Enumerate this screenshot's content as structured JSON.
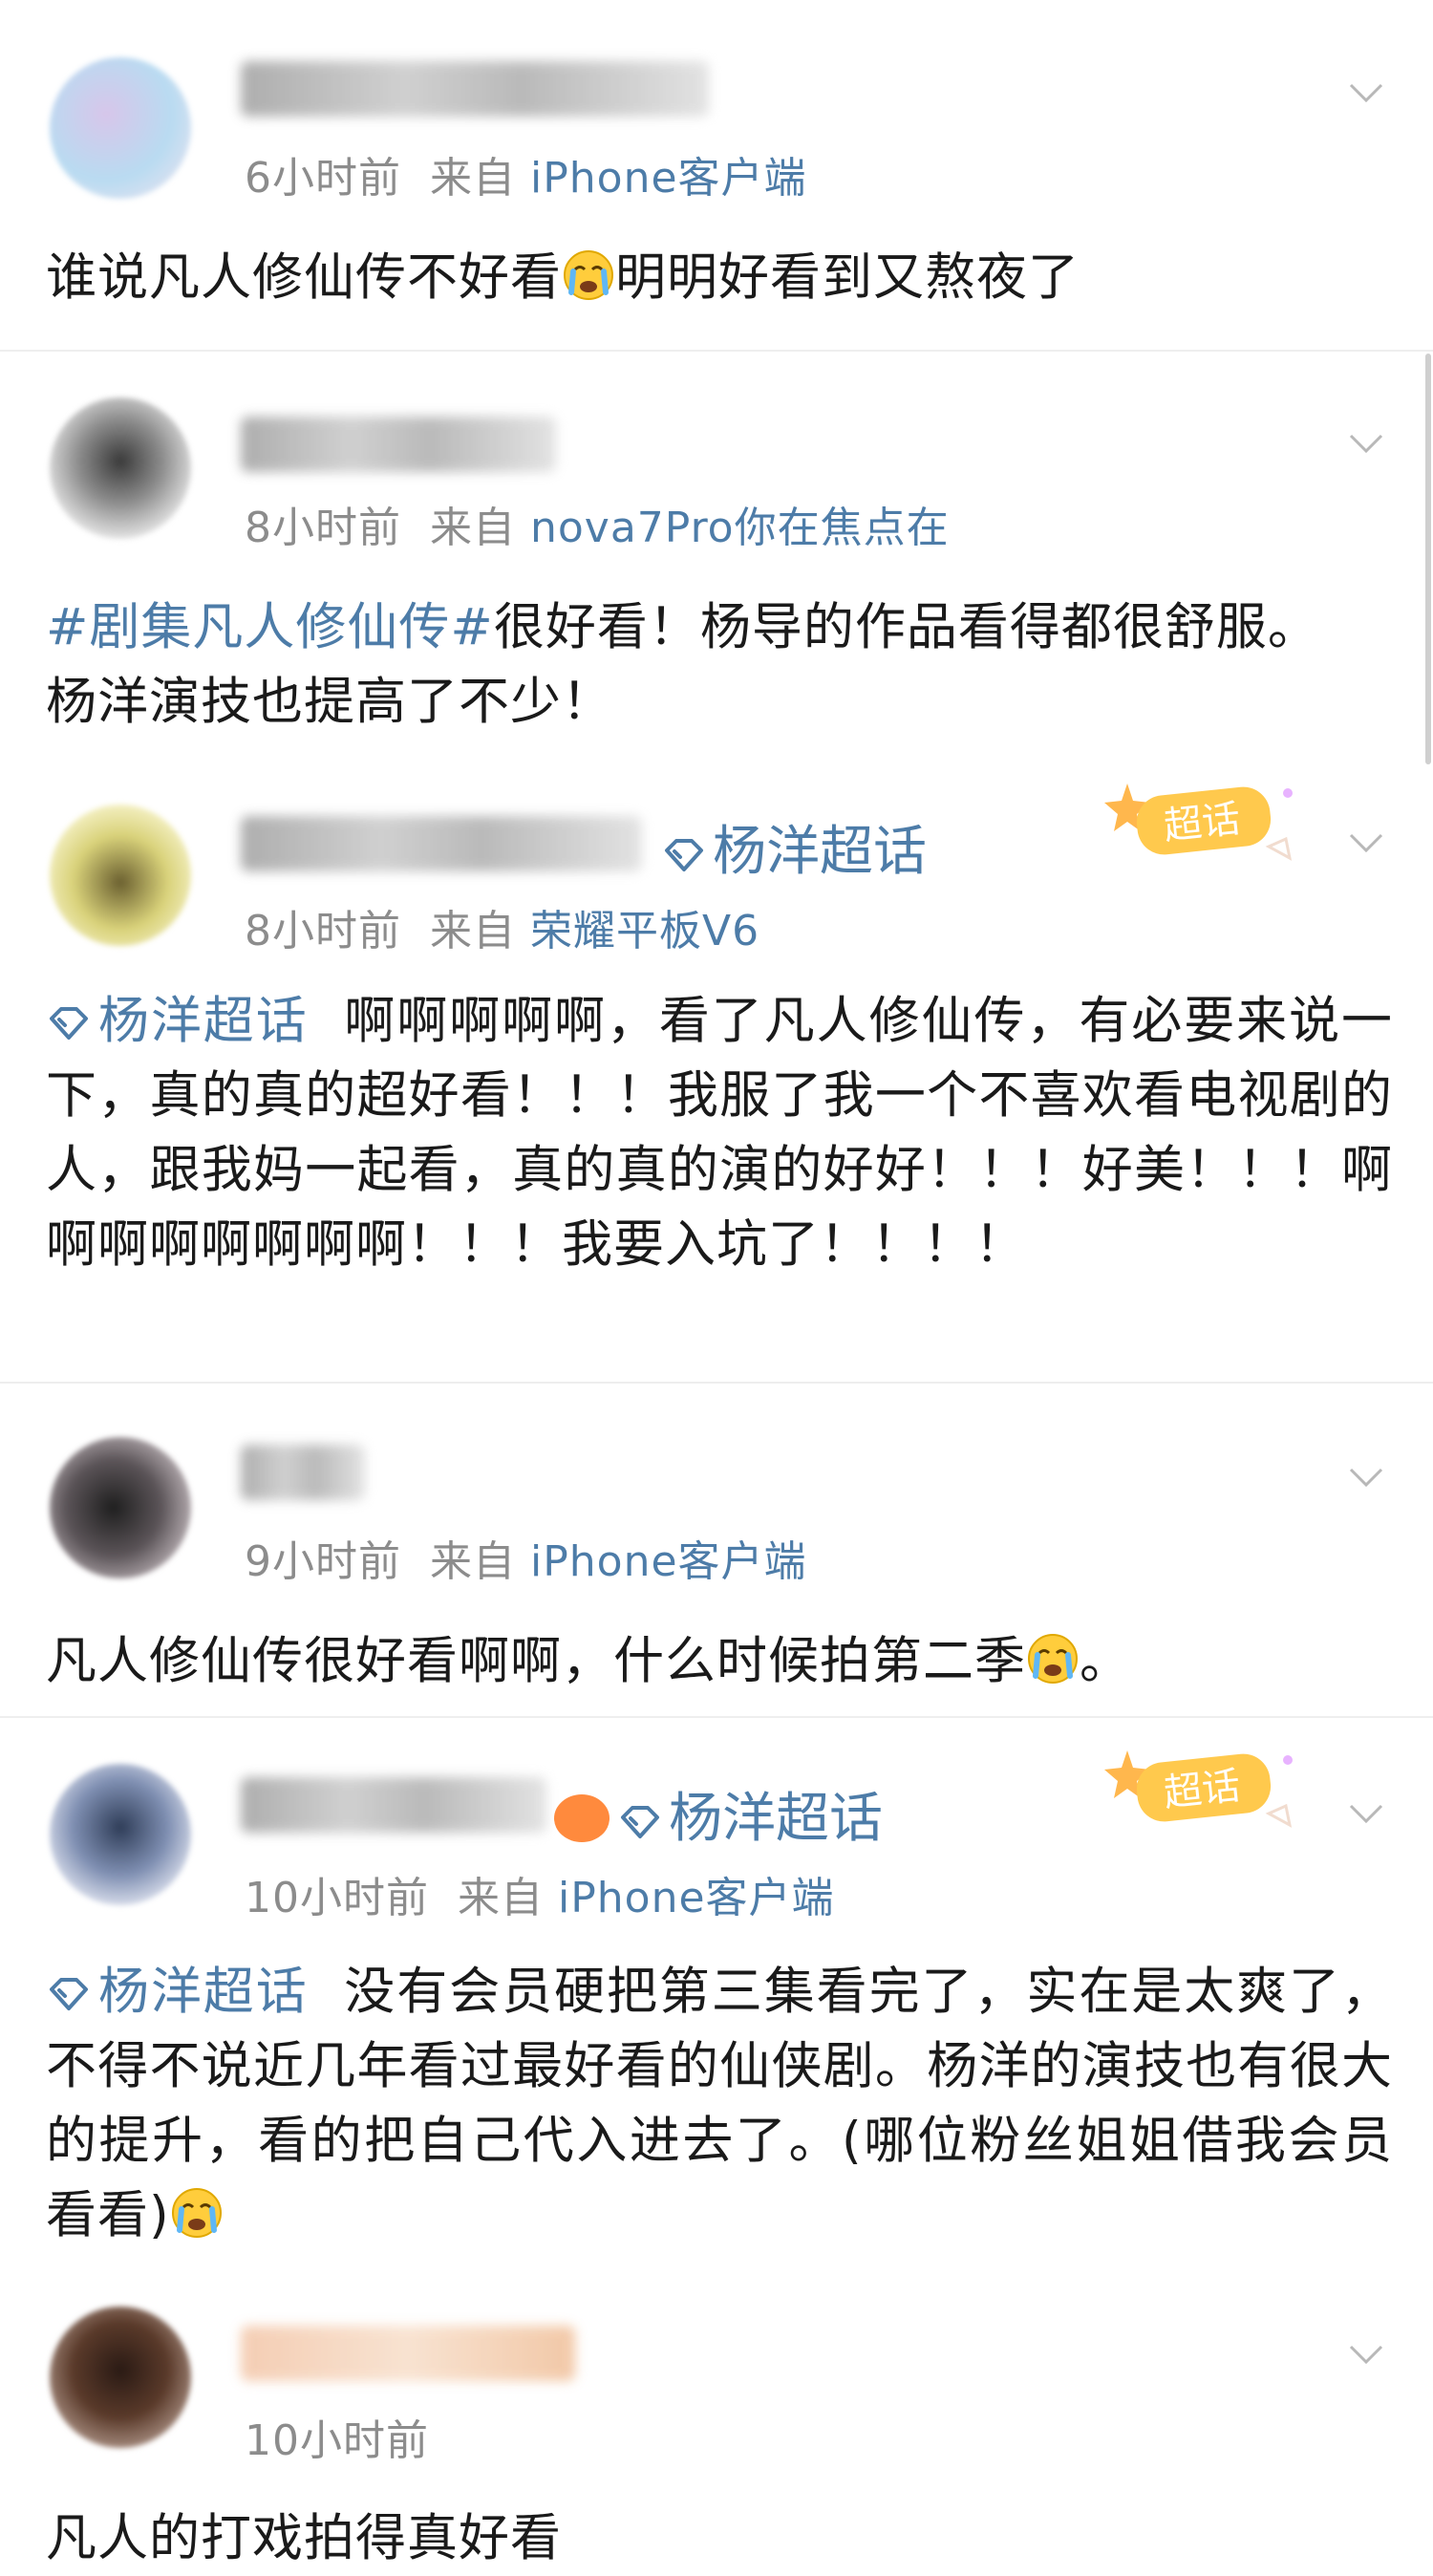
{
  "posts": [
    {
      "time": "6小时前",
      "from": "来自",
      "source": "iPhone客户端",
      "text_parts": [
        "谁说凡人修仙传不好看",
        "明明好看到又熬夜了"
      ]
    },
    {
      "time": "8小时前",
      "from": "来自",
      "source": "nova7Pro你在焦点在",
      "hashtag": "#剧集凡人修仙传#",
      "text_line1": "很好看！杨导的作品看得都很舒服。",
      "text_line2": "杨洋演技也提高了不少！"
    },
    {
      "topic": "杨洋超话",
      "badge": "超话",
      "time": "8小时前",
      "from": "来自",
      "source": "荣耀平板V6",
      "tag": "杨洋超话",
      "text": "啊啊啊啊啊，看了凡人修仙传，有必要来说一下，真的真的超好看！！！我服了我一个不喜欢看电视剧的人，跟我妈一起看，真的真的演的好好！！！好美！！！啊啊啊啊啊啊啊啊！！！我要入坑了！！！！"
    },
    {
      "time": "9小时前",
      "from": "来自",
      "source": "iPhone客户端",
      "text_parts": [
        "凡人修仙传很好看啊啊，什么时候拍第二季",
        "。"
      ]
    },
    {
      "topic": "杨洋超话",
      "badge": "超话",
      "time": "10小时前",
      "from": "来自",
      "source": "iPhone客户端",
      "tag": "杨洋超话",
      "text": "没有会员硬把第三集看完了，实在是太爽了，不得不说近几年看过最好看的仙侠剧。杨洋的演技也有很大的提升，看的把自己代入进去了。(哪位粉丝姐姐借我会员看看)"
    },
    {
      "time": "10小时前",
      "text": "凡人的打戏拍得真好看"
    }
  ],
  "icons": {
    "chevron": "chevron-down-icon",
    "topic": "diamond-topic-icon",
    "emoji_cry": "crying-face-emoji-icon"
  },
  "colors": {
    "link": "#4d7ca8",
    "meta": "#8c8c8c",
    "text": "#1a1a1a"
  }
}
